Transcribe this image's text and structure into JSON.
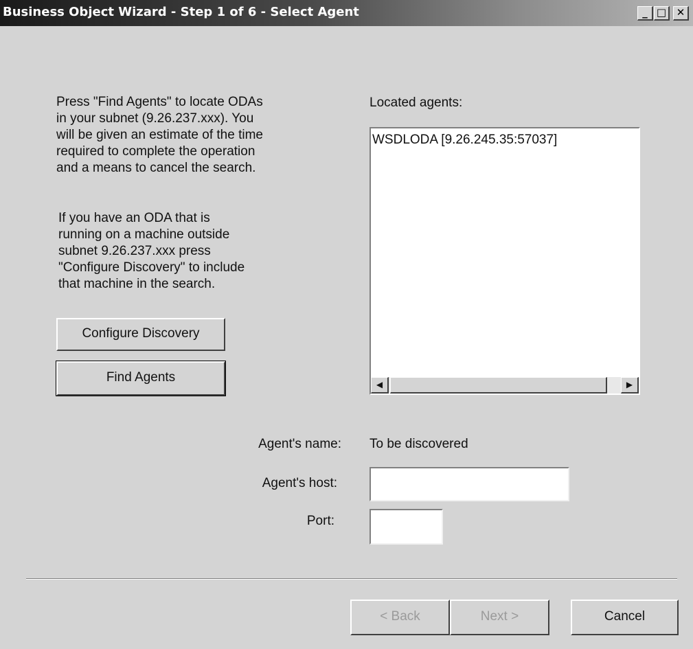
{
  "window": {
    "title": "Business Object Wizard - Step 1 of 6 - Select Agent",
    "minimize": "_",
    "maximize": "□",
    "close": "✕"
  },
  "instructions": {
    "lines1": [
      "Press \"Find Agents\" to locate ODAs",
      "in your subnet (9.26.237.xxx). You",
      "will be given an estimate of the time",
      "required to complete the operation",
      "and a means to cancel the search."
    ],
    "lines2": [
      "If you have an ODA that is",
      "running on a machine outside",
      "subnet 9.26.237.xxx press",
      "\"Configure Discovery\" to include",
      "that machine in the search."
    ]
  },
  "buttons": {
    "configure_discovery": "Configure Discovery",
    "find_agents": "Find Agents",
    "back": "< Back",
    "next": "Next >",
    "cancel": "Cancel"
  },
  "located_agents": {
    "label": "Located agents:",
    "items": [
      "WSDLODA [9.26.245.35:57037]"
    ]
  },
  "scrollbar": {
    "left_arrow": "◀",
    "right_arrow": "▶"
  },
  "agent": {
    "name_label": "Agent's name:",
    "name_value": "To be discovered",
    "host_label": "Agent's host:",
    "host_value": "",
    "port_label": "Port:",
    "port_value": ""
  }
}
